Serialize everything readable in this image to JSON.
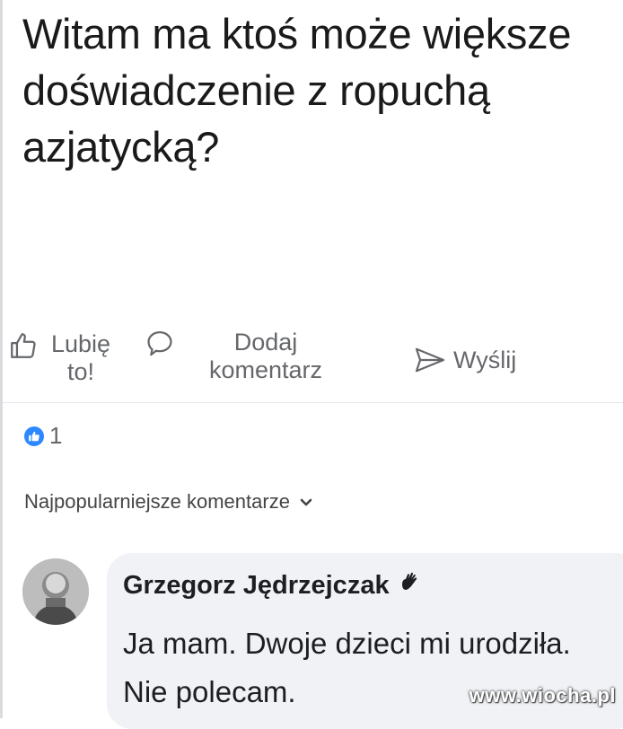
{
  "post": {
    "text": "Witam ma ktoś może większe doświadczenie z ropuchą azjatycką?"
  },
  "actions": {
    "like_label": "Lubię to!",
    "comment_label": "Dodaj komentarz",
    "send_label": "Wyślij"
  },
  "reactions": {
    "count": "1"
  },
  "comments_header": {
    "sort_label": "Najpopularniejsze komentarze"
  },
  "comment": {
    "author": "Grzegorz Jędrzejczak",
    "text": "Ja mam. Dwoje dzieci mi urodziła. Nie polecam."
  },
  "watermark": "www.wiocha.pl",
  "colors": {
    "muted_text": "#65676b",
    "like_blue": "#2d88ff",
    "bubble_bg": "#f0f2f5"
  },
  "icons": [
    "thumbs-up-icon",
    "comment-icon",
    "send-icon",
    "like-reaction-icon",
    "chevron-down-icon",
    "top-fan-badge-icon"
  ]
}
